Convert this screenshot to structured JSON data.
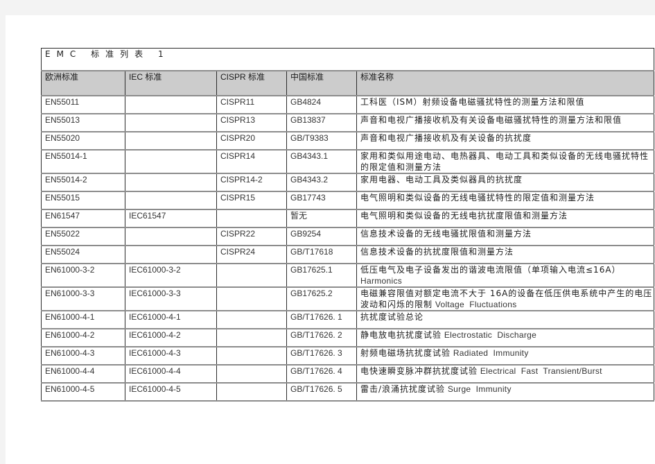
{
  "title": "EMC 标准列表 1",
  "headers": [
    "欧洲标准",
    "IEC 标准",
    "CISPR 标准",
    "中国标准",
    "标准名称"
  ],
  "rows": [
    {
      "eu": "EN55011",
      "iec": "",
      "cispr": "CISPR11",
      "cn": "GB4824",
      "name": "工科医（ISM）射频设备电磁骚扰特性的测量方法和限值",
      "name_en": ""
    },
    {
      "eu": "EN55013",
      "iec": "",
      "cispr": "CISPR13",
      "cn": "GB13837",
      "name": "声音和电视广播接收机及有关设备电磁骚扰特性的测量方法和限值",
      "name_en": ""
    },
    {
      "eu": "EN55020",
      "iec": "",
      "cispr": "CISPR20",
      "cn": "GB/T9383",
      "name": "声音和电视广播接收机及有关设备的抗扰度",
      "name_en": ""
    },
    {
      "eu": "EN55014-1",
      "iec": "",
      "cispr": "CISPR14",
      "cn": "GB4343.1",
      "name": "家用和类似用途电动、电热器具、电动工具和类似设备的无线电骚扰特性的限定值和测量方法",
      "name_en": ""
    },
    {
      "eu": "EN55014-2",
      "iec": "",
      "cispr": "CISPR14-2",
      "cn": "GB4343.2",
      "name": "家用电器、电动工具及类似器具的抗扰度",
      "name_en": ""
    },
    {
      "eu": "EN55015",
      "iec": "",
      "cispr": "CISPR15",
      "cn": "GB17743",
      "name": "电气照明和类似设备的无线电骚扰特性的限定值和测量方法",
      "name_en": ""
    },
    {
      "eu": "EN61547",
      "iec": "IEC61547",
      "cispr": "",
      "cn": "暂无",
      "name": "电气照明和类似设备的无线电抗扰度限值和测量方法",
      "name_en": ""
    },
    {
      "eu": "EN55022",
      "iec": "",
      "cispr": "CISPR22",
      "cn": "GB9254",
      "name": "信息技术设备的无线电骚扰限值和测量方法",
      "name_en": ""
    },
    {
      "eu": "EN55024",
      "iec": "",
      "cispr": "CISPR24",
      "cn": "GB/T17618",
      "name": "信息技术设备的抗扰度限值和测量方法",
      "name_en": ""
    },
    {
      "eu": "EN61000-3-2",
      "iec": "IEC61000-3-2",
      "cispr": "",
      "cn": "GB17625.1",
      "name": "低压电气及电子设备发出的谐波电流限值（单项输入电流≤16A）",
      "name_en": "Harmonics"
    },
    {
      "eu": "EN61000-3-3",
      "iec": "IEC61000-3-3",
      "cispr": "",
      "cn": "GB17625.2",
      "name": "电磁兼容限值对额定电流不大于 16A的设备在低压供电系统中产生的电压波动和闪烁的限制",
      "name_en": "Voltage  Fluctuations"
    },
    {
      "eu": "EN61000-4-1",
      "iec": "IEC61000-4-1",
      "cispr": "",
      "cn": "GB/T17626. 1",
      "name": "抗扰度试验总论",
      "name_en": ""
    },
    {
      "eu": "EN61000-4-2",
      "iec": "IEC61000-4-2",
      "cispr": "",
      "cn": "GB/T17626. 2",
      "name": "静电放电抗扰度试验",
      "name_en": "Electrostatic  Discharge"
    },
    {
      "eu": "EN61000-4-3",
      "iec": "IEC61000-4-3",
      "cispr": "",
      "cn": "GB/T17626. 3",
      "name": "射频电磁场抗扰度试验",
      "name_en": "Radiated  Immunity"
    },
    {
      "eu": "EN61000-4-4",
      "iec": "IEC61000-4-4",
      "cispr": "",
      "cn": "GB/T17626. 4",
      "name": "电快速瞬变脉冲群抗扰度试验",
      "name_en": "Electrical  Fast  Transient/Burst"
    },
    {
      "eu": "EN61000-4-5",
      "iec": "IEC61000-4-5",
      "cispr": "",
      "cn": "GB/T17626. 5",
      "name": "雷击/浪涌抗扰度试验",
      "name_en": "Surge  Immunity"
    }
  ]
}
